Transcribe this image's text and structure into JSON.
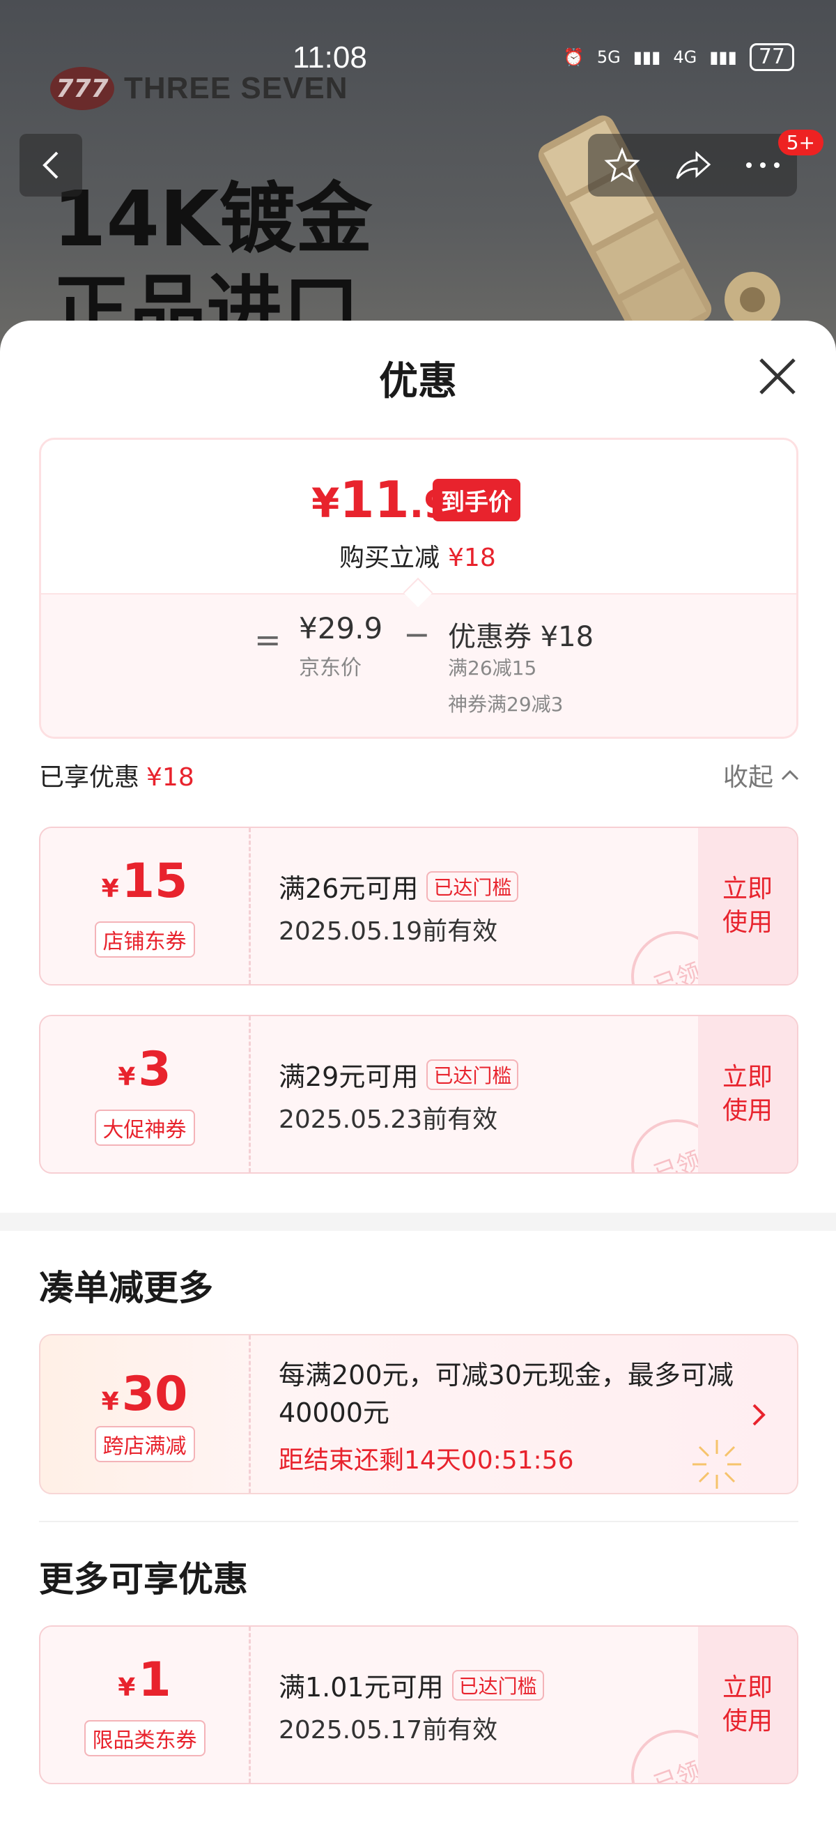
{
  "status_bar": {
    "time": "11:08",
    "network1": "5G",
    "network2": "4G",
    "battery": "77"
  },
  "banner": {
    "brand_name": "THREE SEVEN",
    "brand_logo": "777",
    "headline_line1": "14K镀金",
    "headline_line2": "正品进口",
    "notification_badge": "5+"
  },
  "sheet": {
    "title": "优惠",
    "price": {
      "currency": "¥",
      "int": "11",
      "dec": ".9",
      "tag": "到手价",
      "instant_label": "购买立减",
      "instant_amount": "¥18"
    },
    "breakdown": {
      "equals": "=",
      "jd_price": "¥29.9",
      "jd_label": "京东价",
      "minus": "−",
      "coupon_total": "优惠券 ¥18",
      "detail1": "满26减15",
      "detail2": "神券满29减3"
    },
    "enjoyed": {
      "label": "已享优惠",
      "amount": "¥18"
    },
    "collapse_label": "收起"
  },
  "coupons": [
    {
      "yen": "¥",
      "amount": "15",
      "type": "店铺东券",
      "condition": "满26元可用",
      "reached": "已达门槛",
      "valid": "2025.05.19前有效",
      "action": "立即\n使用",
      "action1": "立即",
      "action2": "使用",
      "stamp": "已领"
    },
    {
      "yen": "¥",
      "amount": "3",
      "type": "大促神券",
      "condition": "满29元可用",
      "reached": "已达门槛",
      "valid": "2025.05.23前有效",
      "action1": "立即",
      "action2": "使用",
      "stamp": "已领"
    }
  ],
  "more_deals": {
    "title": "凑单减更多",
    "promo": {
      "yen": "¥",
      "amount": "30",
      "type": "跨店满减",
      "desc": "每满200元，可减30元现金，最多可减40000元",
      "countdown": "距结束还剩14天00:51:56"
    }
  },
  "more_offers": {
    "title": "更多可享优惠",
    "coupon": {
      "yen": "¥",
      "amount": "1",
      "type": "限品类东券",
      "condition": "满1.01元可用",
      "reached": "已达门槛",
      "valid": "2025.05.17前有效",
      "action1": "立即",
      "action2": "使用",
      "stamp": "已领"
    }
  },
  "icons": [
    "back-arrow-icon",
    "star-icon",
    "share-icon",
    "more-icon",
    "close-icon",
    "chevron-up-icon",
    "chevron-right-icon"
  ]
}
